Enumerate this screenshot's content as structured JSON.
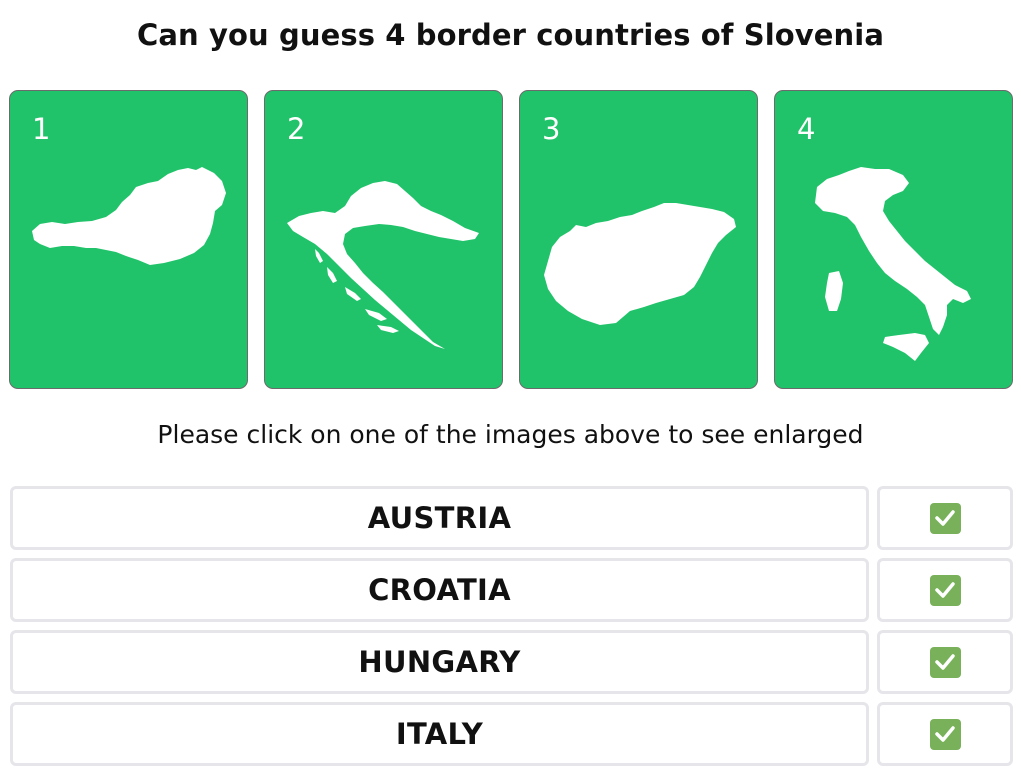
{
  "quiz": {
    "title": "Can you guess 4 border countries of Slovenia",
    "hint": "Please click on one of the images above to see enlarged"
  },
  "cards": [
    {
      "number": "1",
      "shape": "austria-silhouette"
    },
    {
      "number": "2",
      "shape": "croatia-silhouette"
    },
    {
      "number": "3",
      "shape": "hungary-silhouette"
    },
    {
      "number": "4",
      "shape": "italy-silhouette"
    }
  ],
  "answers": [
    {
      "label": "AUSTRIA",
      "status": "correct"
    },
    {
      "label": "CROATIA",
      "status": "correct"
    },
    {
      "label": "HUNGARY",
      "status": "correct"
    },
    {
      "label": "ITALY",
      "status": "correct"
    }
  ],
  "colors": {
    "card_bg": "#20c36a",
    "check_bg": "#78b159",
    "box_border": "#e6e6ea"
  },
  "icons": {
    "check": "check-mark-icon"
  }
}
